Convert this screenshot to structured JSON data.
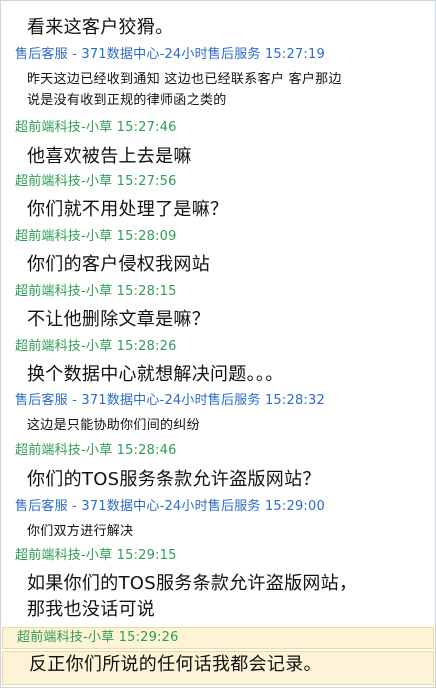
{
  "colors": {
    "agent_header": "#2c6cc6",
    "customer_header": "#2e9e55",
    "highlight_bg": "#fdf3d6"
  },
  "messages": [
    {
      "kind": "msg",
      "size": "big",
      "text": "看来这客户狡猾。"
    },
    {
      "kind": "hdr",
      "sender": "agent",
      "name": "售后客服 - 371数据中心-24小时售后服务",
      "time": "15:27:19"
    },
    {
      "kind": "msg",
      "size": "small",
      "text": "昨天这边已经收到通知  这边也已经联系客户  客户那边\n说是没有收到正规的律师函之类的"
    },
    {
      "kind": "hdr",
      "sender": "customer",
      "name": "超前端科技-小草",
      "time": "15:27:46"
    },
    {
      "kind": "msg",
      "size": "big",
      "text": "他喜欢被告上去是嘛"
    },
    {
      "kind": "hdr",
      "sender": "customer",
      "name": "超前端科技-小草",
      "time": "15:27:56"
    },
    {
      "kind": "msg",
      "size": "big",
      "text": "你们就不用处理了是嘛？"
    },
    {
      "kind": "hdr",
      "sender": "customer",
      "name": "超前端科技-小草",
      "time": "15:28:09"
    },
    {
      "kind": "msg",
      "size": "big",
      "text": "你们的客户侵权我网站"
    },
    {
      "kind": "hdr",
      "sender": "customer",
      "name": "超前端科技-小草",
      "time": "15:28:15"
    },
    {
      "kind": "msg",
      "size": "big",
      "text": "不让他删除文章是嘛？"
    },
    {
      "kind": "hdr",
      "sender": "customer",
      "name": "超前端科技-小草",
      "time": "15:28:26"
    },
    {
      "kind": "msg",
      "size": "big",
      "text": "换个数据中心就想解决问题。。。"
    },
    {
      "kind": "hdr",
      "sender": "agent",
      "name": "售后客服 - 371数据中心-24小时售后服务",
      "time": "15:28:32"
    },
    {
      "kind": "msg",
      "size": "small",
      "text": "这边是只能协助你们间的纠纷"
    },
    {
      "kind": "hdr",
      "sender": "customer",
      "name": "超前端科技-小草",
      "time": "15:28:46"
    },
    {
      "kind": "msg",
      "size": "big",
      "text": "你们的TOS服务条款允许盗版网站？"
    },
    {
      "kind": "hdr",
      "sender": "agent",
      "name": "售后客服 - 371数据中心-24小时售后服务",
      "time": "15:29:00"
    },
    {
      "kind": "msg",
      "size": "small",
      "text": "你们双方进行解决"
    },
    {
      "kind": "hdr",
      "sender": "customer",
      "name": "超前端科技-小草",
      "time": "15:29:15"
    },
    {
      "kind": "msg",
      "size": "big",
      "text": "如果你们的TOS服务条款允许盗版网站，\n那我也没话可说"
    },
    {
      "kind": "hdr",
      "sender": "customer",
      "name": "超前端科技-小草",
      "time": "15:29:26",
      "highlight": true
    },
    {
      "kind": "msg",
      "size": "big",
      "text": "反正你们所说的任何话我都会记录。",
      "highlight": true
    }
  ]
}
